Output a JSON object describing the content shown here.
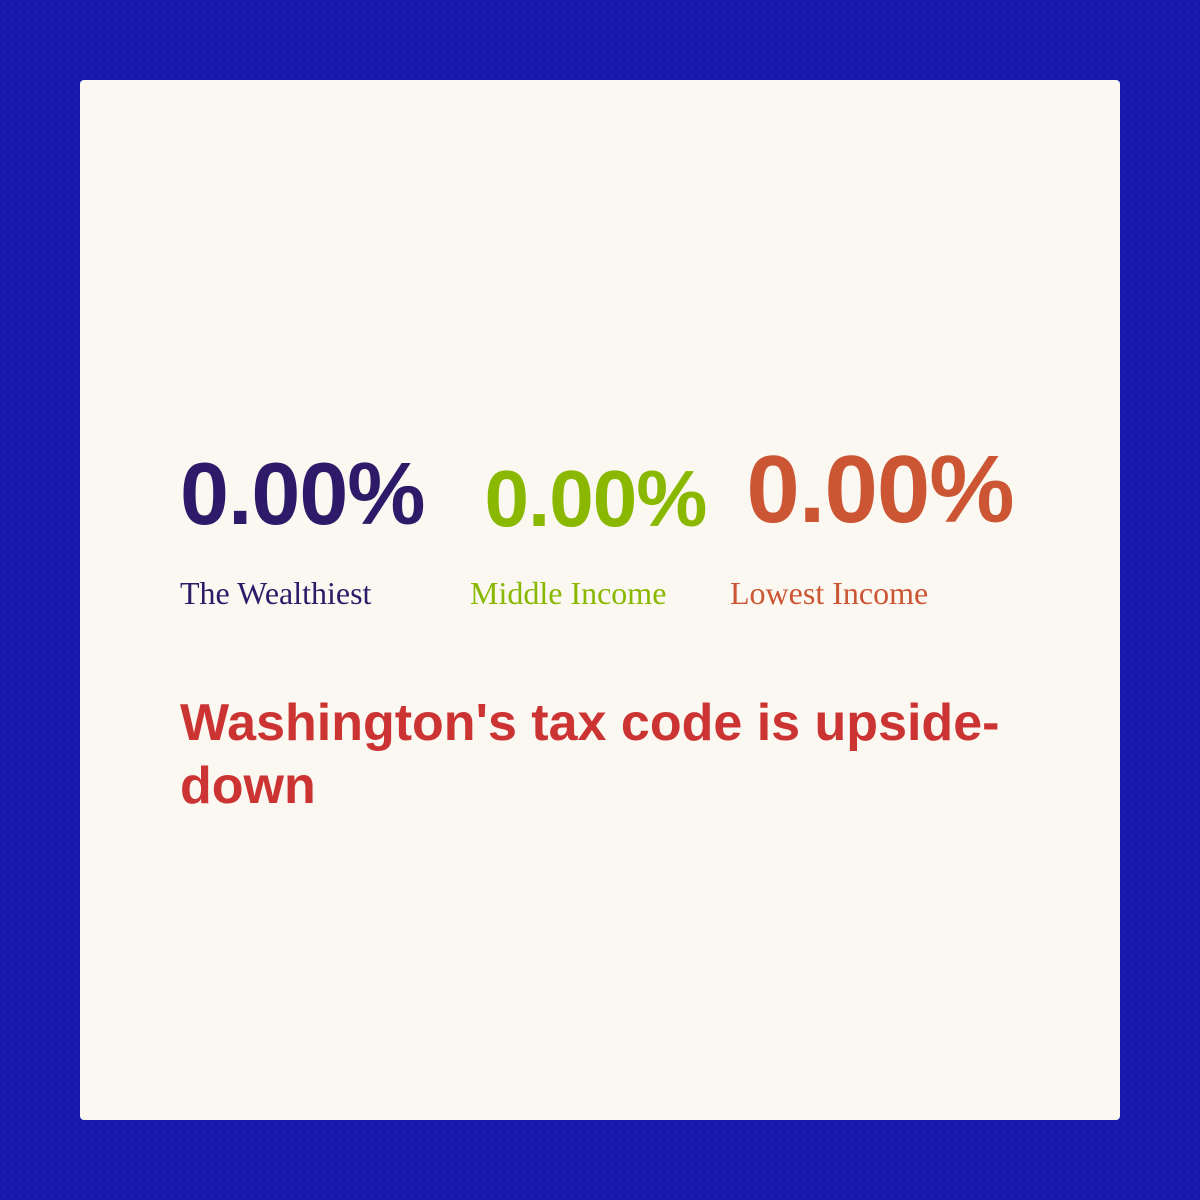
{
  "card": {
    "wealthiest": {
      "percentage": "0.00%",
      "label": "The Wealthiest"
    },
    "middle": {
      "percentage": "0.00%",
      "label": "Middle Income"
    },
    "lowest": {
      "percentage": "0.00%",
      "label": "Lowest Income"
    },
    "tagline": "Washington's tax code is upside-down"
  },
  "colors": {
    "background": "#1a1aaa",
    "card_bg": "#faf8f0",
    "wealthiest_color": "#2d1b69",
    "middle_color": "#8ab800",
    "lowest_color": "#cc5533",
    "tagline_color": "#cc3333"
  }
}
